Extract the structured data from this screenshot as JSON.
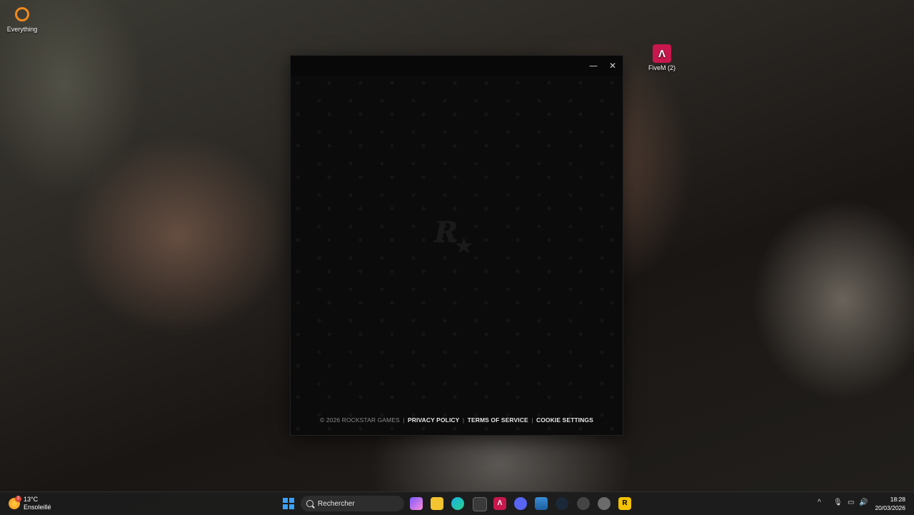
{
  "desktop": {
    "icons": [
      {
        "label": "Everything"
      },
      {
        "label": "FiveM (2)"
      }
    ]
  },
  "launcher": {
    "footer": {
      "copyright": "© 2026 ROCKSTAR GAMES",
      "privacy": "PRIVACY POLICY",
      "terms": "TERMS OF SERVICE",
      "cookies": "COOKIE SETTINGS",
      "separator": "|"
    },
    "logo_letter": "R",
    "logo_star": "★",
    "minimize_glyph": "—",
    "close_glyph": "✕"
  },
  "taskbar": {
    "weather": {
      "temp": "13°C",
      "condition": "Ensoleillé",
      "badge": "2"
    },
    "search_placeholder": "Rechercher",
    "tray_chevron": "^",
    "clock": {
      "time": "18:28",
      "date": "20/03/2026"
    },
    "colors": {
      "accent": "#3aa0ff",
      "fivem": "#c8174c",
      "rockstar": "#f2c200"
    }
  }
}
